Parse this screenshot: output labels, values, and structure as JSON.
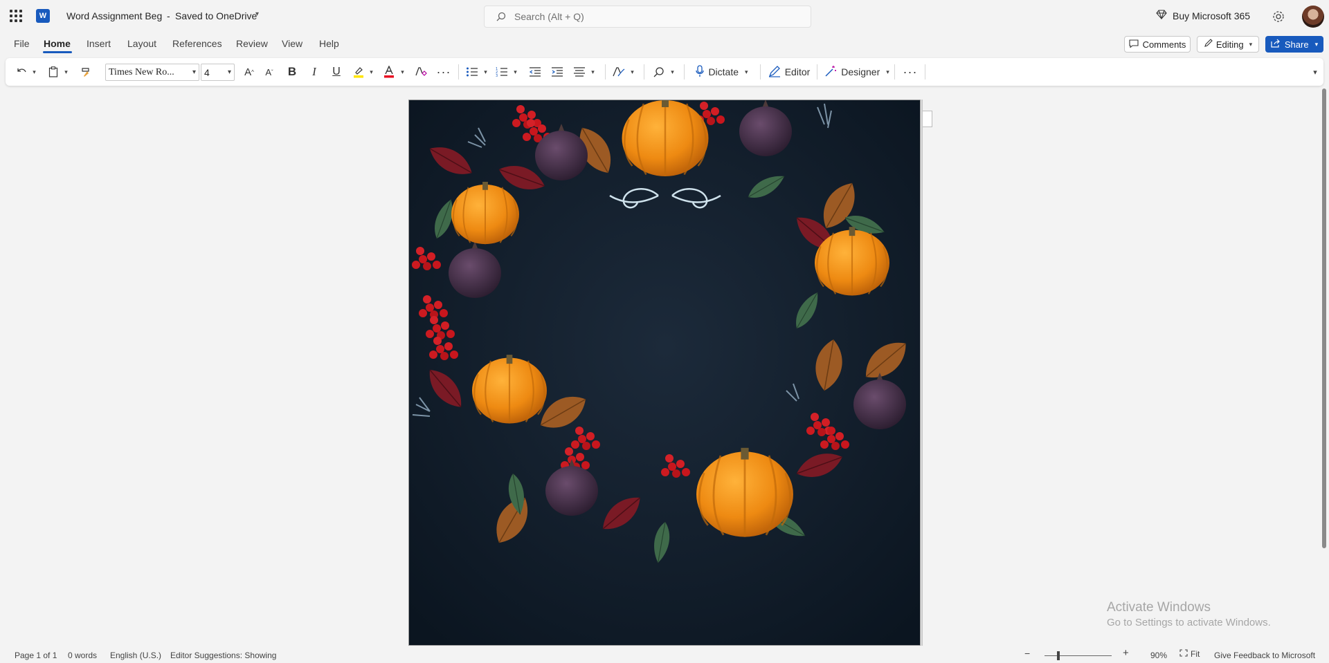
{
  "title_bar": {
    "doc_title": "Word Assignment Beg",
    "separator": "-",
    "saved_status": "Saved to OneDrive",
    "search_placeholder": "Search (Alt + Q)",
    "buy_label": "Buy Microsoft 365"
  },
  "tabs": [
    "File",
    "Home",
    "Insert",
    "Layout",
    "References",
    "Review",
    "View",
    "Help"
  ],
  "active_tab": "Home",
  "actions": {
    "comments": "Comments",
    "editing": "Editing",
    "share": "Share"
  },
  "ribbon": {
    "font_name": "Times New Ro...",
    "font_size": "4",
    "bold": "B",
    "italic": "I",
    "underline": "U",
    "dictate": "Dictate",
    "editor": "Editor",
    "designer": "Designer"
  },
  "colors": {
    "accent": "#185abd",
    "highlight": "#ffe500",
    "font_color": "#e81123",
    "page_bg": "#0f1b28"
  },
  "watermark": {
    "line1": "Activate Windows",
    "line2": "Go to Settings to activate Windows."
  },
  "status_bar": {
    "page": "Page 1 of 1",
    "words": "0 words",
    "language": "English (U.S.)",
    "editor_suggestions": "Editor Suggestions: Showing",
    "zoom": "90%",
    "fit": "Fit",
    "feedback": "Give Feedback to Microsoft"
  }
}
